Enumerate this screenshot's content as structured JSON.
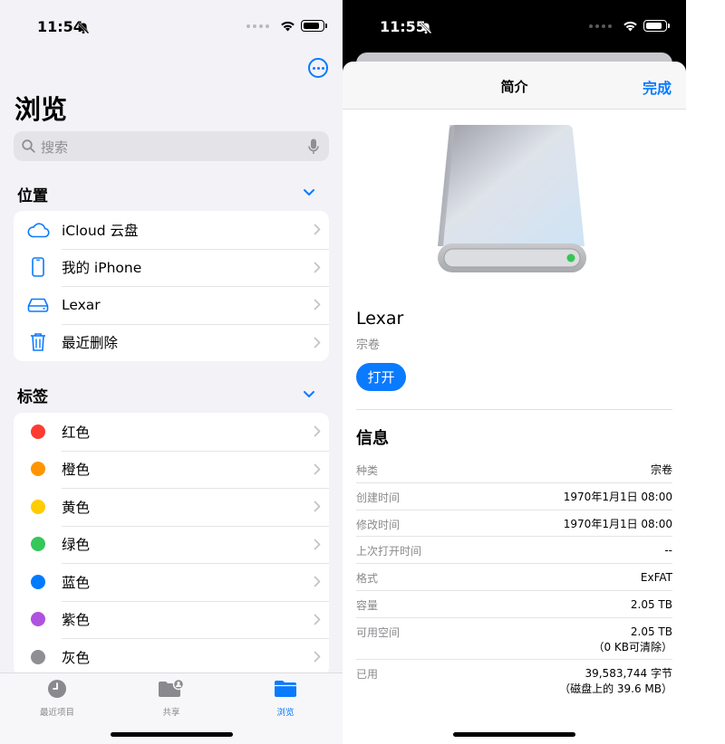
{
  "left": {
    "status": {
      "time": "11:54"
    },
    "title": "浏览",
    "search": {
      "placeholder": "搜索"
    },
    "locations": {
      "header": "位置",
      "items": [
        {
          "label": "iCloud 云盘",
          "icon": "cloud-icon"
        },
        {
          "label": "我的 iPhone",
          "icon": "iphone-icon"
        },
        {
          "label": "Lexar",
          "icon": "drive-icon"
        },
        {
          "label": "最近删除",
          "icon": "trash-icon"
        }
      ]
    },
    "tags": {
      "header": "标签",
      "items": [
        {
          "label": "红色",
          "color": "#ff3b30"
        },
        {
          "label": "橙色",
          "color": "#ff9500"
        },
        {
          "label": "黄色",
          "color": "#ffcc00"
        },
        {
          "label": "绿色",
          "color": "#34c759"
        },
        {
          "label": "蓝色",
          "color": "#007aff"
        },
        {
          "label": "紫色",
          "color": "#af52de"
        },
        {
          "label": "灰色",
          "color": "#8e8e93"
        }
      ]
    },
    "tabbar": {
      "recents": "最近项目",
      "shared": "共享",
      "browse": "浏览"
    }
  },
  "right": {
    "status": {
      "time": "11:55"
    },
    "nav": {
      "title": "简介",
      "done": "完成"
    },
    "volume": {
      "name": "Lexar",
      "kind": "宗卷",
      "open": "打开"
    },
    "info": {
      "title": "信息",
      "rows": [
        {
          "key": "种类",
          "value": "宗卷"
        },
        {
          "key": "创建时间",
          "value": "1970年1月1日 08:00"
        },
        {
          "key": "修改时间",
          "value": "1970年1月1日 08:00"
        },
        {
          "key": "上次打开时间",
          "value": "--"
        },
        {
          "key": "格式",
          "value": "ExFAT"
        },
        {
          "key": "容量",
          "value": "2.05 TB"
        },
        {
          "key": "可用空间",
          "value": "2.05 TB",
          "value2": "（0 KB可清除）"
        },
        {
          "key": "已用",
          "value": "39,583,744 字节",
          "value2": "（磁盘上的 39.6 MB）"
        }
      ]
    }
  },
  "colors": {
    "accent": "#0a7aff",
    "background": "#f2f2f7"
  }
}
